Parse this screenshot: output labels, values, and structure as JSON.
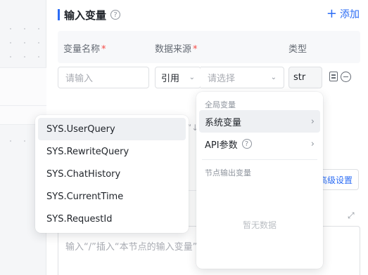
{
  "section": {
    "title": "输入变量",
    "help": "?",
    "add_label": "添加"
  },
  "table": {
    "headers": [
      {
        "label": "变量名称",
        "required": true
      },
      {
        "label": "数据来源",
        "required": true
      },
      {
        "label": "类型",
        "required": false
      }
    ],
    "row": {
      "name_placeholder": "请输入",
      "source_mode": "引用",
      "source_placeholder": "请选择",
      "type_value": "str"
    }
  },
  "background": {
    "hint_fragment": "“↓",
    "advanced_label": "高级设置",
    "prompt_placeholder": "输入“/”插入“本节点的输入变量”"
  },
  "variable_menu": {
    "group_global": "全局变量",
    "items": [
      {
        "label": "系统变量",
        "has_help": false
      },
      {
        "label": "API参数",
        "has_help": true
      }
    ],
    "group_node_output": "节点输出变量",
    "empty_text": "暂无数据"
  },
  "system_vars": [
    "SYS.UserQuery",
    "SYS.RewriteQuery",
    "SYS.ChatHistory",
    "SYS.CurrentTime",
    "SYS.RequestId"
  ],
  "colors": {
    "accent": "#2b6cf5",
    "required": "#f54a45"
  }
}
